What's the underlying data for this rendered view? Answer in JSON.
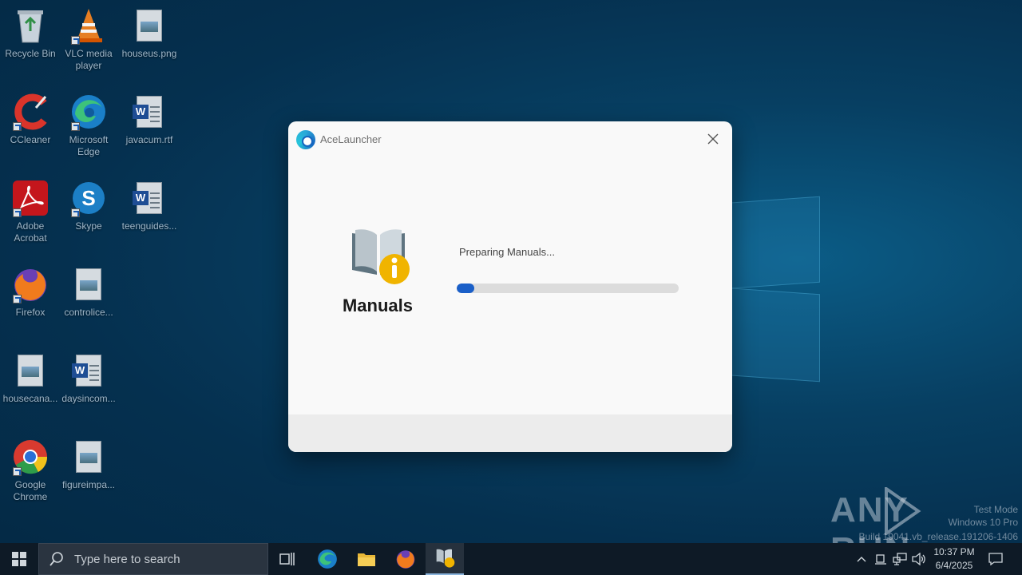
{
  "desktop": {
    "icons": [
      {
        "label": "Recycle Bin"
      },
      {
        "label": "VLC media player"
      },
      {
        "label": "houseus.png"
      },
      {
        "label": "CCleaner"
      },
      {
        "label": "Microsoft Edge"
      },
      {
        "label": "javacum.rtf"
      },
      {
        "label": "Adobe Acrobat"
      },
      {
        "label": "Skype"
      },
      {
        "label": "teenguides..."
      },
      {
        "label": "Firefox"
      },
      {
        "label": "controlice..."
      },
      {
        "label": "housecana..."
      },
      {
        "label": "daysincom..."
      },
      {
        "label": "Google Chrome"
      },
      {
        "label": "figureimpa..."
      }
    ]
  },
  "dialog": {
    "app_title": "AceLauncher",
    "product_name": "Manuals",
    "status_text": "Preparing Manuals...",
    "progress_fraction": 0.08,
    "accent_color": "#1a5fc8"
  },
  "taskbar": {
    "search_placeholder": "Type here to search",
    "clock_time": "10:37 PM",
    "clock_date": "6/4/2025"
  },
  "watermark": {
    "brand": "ANY RUN",
    "test_mode": "Test Mode",
    "os_edition": "Windows 10 Pro",
    "build": "Build 19041.vb_release.191206-1406"
  }
}
